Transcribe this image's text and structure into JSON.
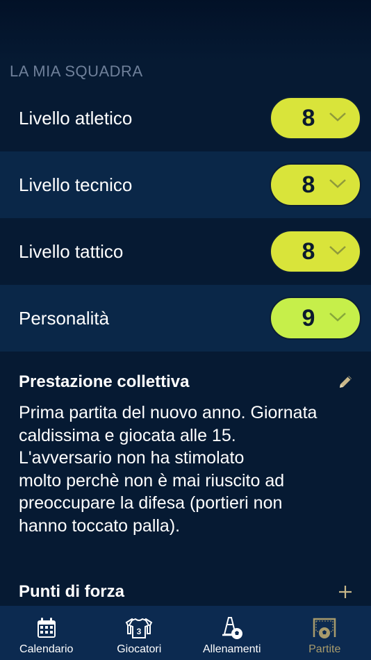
{
  "section": {
    "title": "LA MIA SQUADRA"
  },
  "ratings": [
    {
      "label": "Livello atletico",
      "value": "8",
      "pill_color": "#d9e43a"
    },
    {
      "label": "Livello tecnico",
      "value": "8",
      "pill_color": "#d9e43a"
    },
    {
      "label": "Livello tattico",
      "value": "8",
      "pill_color": "#d9e43a"
    },
    {
      "label": "Personalità",
      "value": "9",
      "pill_color": "#c6ef4a"
    }
  ],
  "collective": {
    "title": "Prestazione collettiva",
    "text": "Prima partita del nuovo anno. Giornata\ncaldissima e giocata alle 15.\nL'avversario non ha stimolato\nmolto perchè non è mai riuscito ad\npreoccupare la difesa (portieri non\nhanno toccato palla).",
    "edit_icon": "pencil-icon"
  },
  "strengths": {
    "title": "Punti di forza",
    "add_icon": "plus-icon"
  },
  "tabbar": {
    "items": [
      {
        "label": "Calendario",
        "icon": "calendar-icon",
        "active": false
      },
      {
        "label": "Giocatori",
        "icon": "jersey-icon",
        "active": false
      },
      {
        "label": "Allenamenti",
        "icon": "cone-ball-icon",
        "active": false
      },
      {
        "label": "Partite",
        "icon": "goal-icon",
        "active": true
      }
    ]
  },
  "colors": {
    "background": "#061a33",
    "row_alt": "#0a2748",
    "tabbar": "#0c2a50",
    "accent_active": "#a89b6c"
  }
}
